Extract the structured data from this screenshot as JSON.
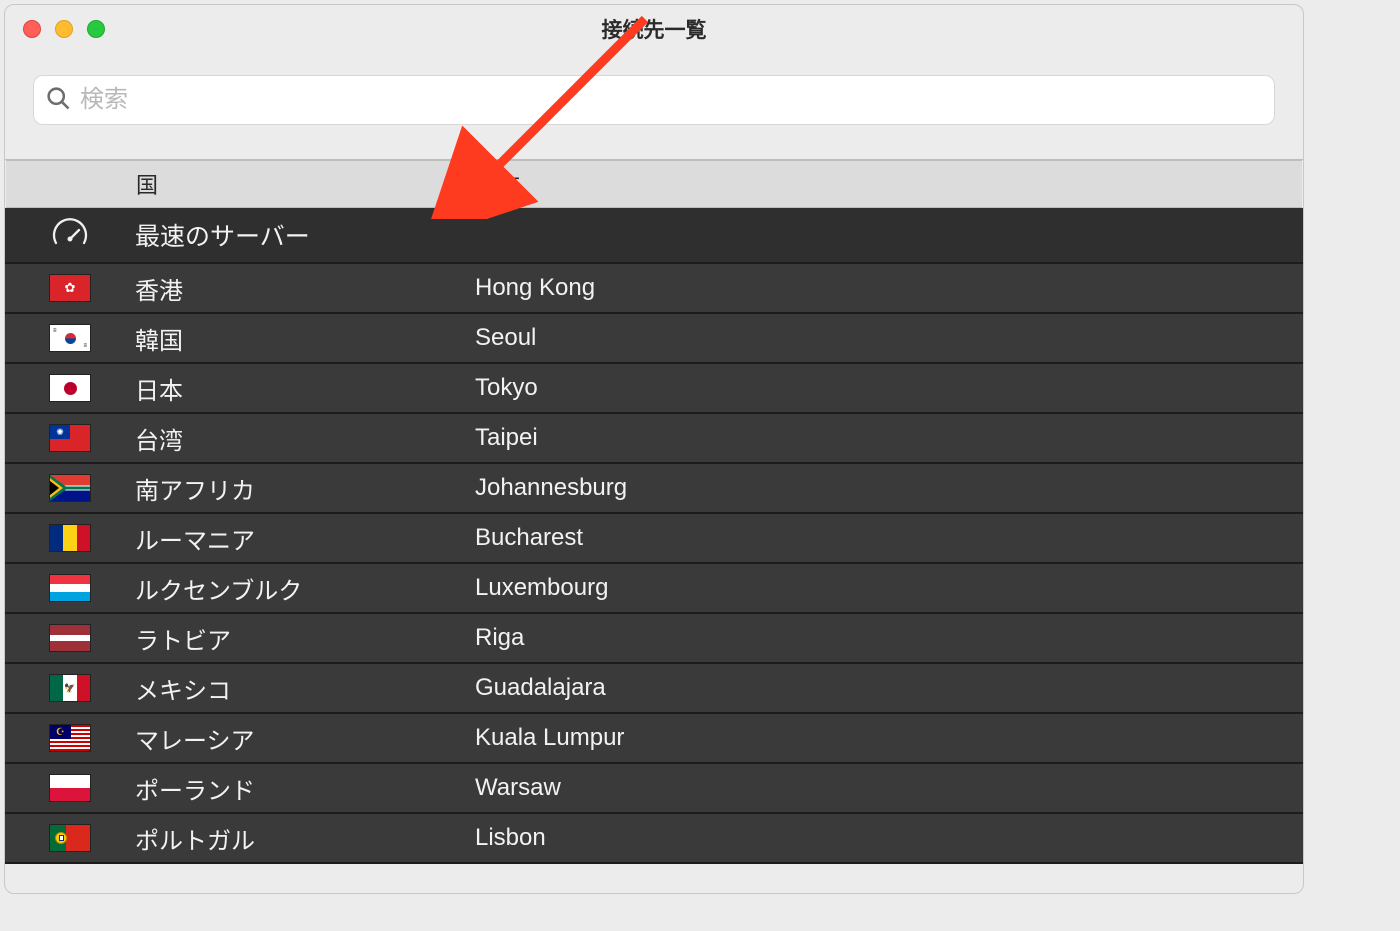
{
  "window": {
    "title": "接続先一覧"
  },
  "search": {
    "placeholder": "検索"
  },
  "headers": {
    "country": "国",
    "city": "都市"
  },
  "fastest": {
    "label": "最速のサーバー"
  },
  "rows": [
    {
      "flag": "hk",
      "country": "香港",
      "city": "Hong Kong"
    },
    {
      "flag": "kr",
      "country": "韓国",
      "city": "Seoul"
    },
    {
      "flag": "jp",
      "country": "日本",
      "city": "Tokyo"
    },
    {
      "flag": "tw",
      "country": "台湾",
      "city": "Taipei"
    },
    {
      "flag": "za",
      "country": "南アフリカ",
      "city": "Johannesburg"
    },
    {
      "flag": "ro",
      "country": "ルーマニア",
      "city": "Bucharest"
    },
    {
      "flag": "lu",
      "country": "ルクセンブルク",
      "city": "Luxembourg"
    },
    {
      "flag": "lv",
      "country": "ラトビア",
      "city": "Riga"
    },
    {
      "flag": "mx",
      "country": "メキシコ",
      "city": "Guadalajara"
    },
    {
      "flag": "my",
      "country": "マレーシア",
      "city": "Kuala Lumpur"
    },
    {
      "flag": "pl",
      "country": "ポーランド",
      "city": "Warsaw"
    },
    {
      "flag": "pt",
      "country": "ポルトガル",
      "city": "Lisbon"
    }
  ]
}
